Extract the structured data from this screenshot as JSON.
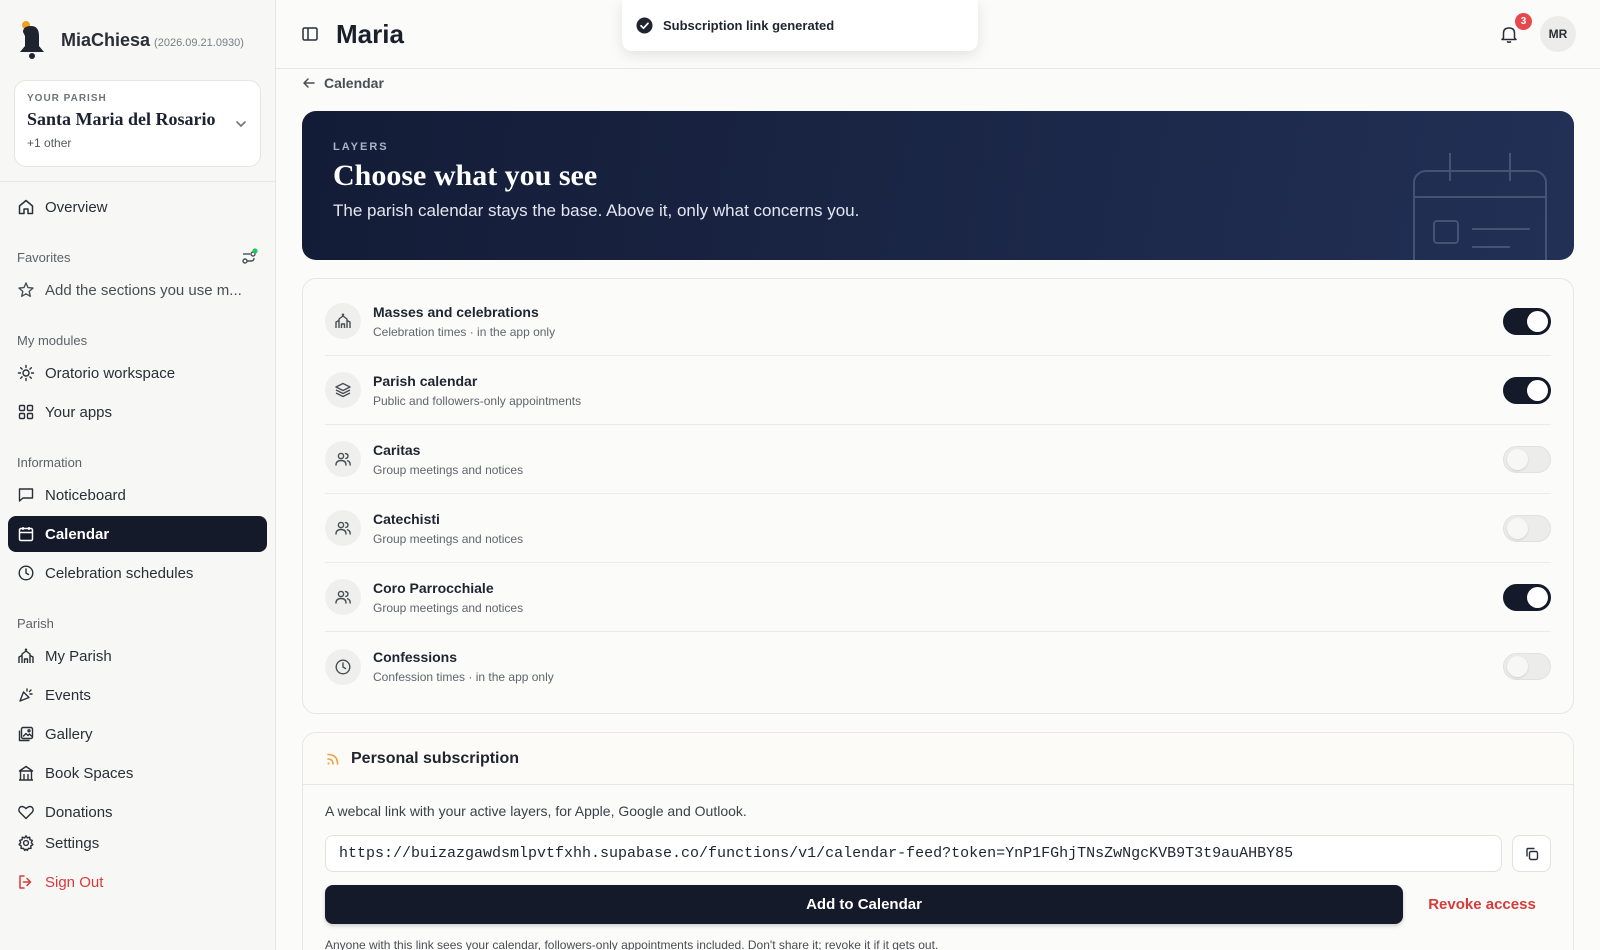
{
  "brand": {
    "name": "MiaChiesa",
    "version": "(2026.09.21.0930)"
  },
  "parish": {
    "kicker": "YOUR PARISH",
    "name": "Santa Maria del Rosario",
    "other": "+1 other"
  },
  "sidebar": {
    "overview": "Overview",
    "favorites_title": "Favorites",
    "favorites_hint": "Add the sections you use m...",
    "modules_title": "My modules",
    "modules": [
      "Oratorio workspace",
      "Your apps"
    ],
    "information_title": "Information",
    "information": [
      "Noticeboard",
      "Calendar",
      "Celebration schedules"
    ],
    "parish_title": "Parish",
    "parish": [
      "My Parish",
      "Events",
      "Gallery",
      "Book Spaces",
      "Donations"
    ],
    "settings": "Settings",
    "signout": "Sign Out"
  },
  "header": {
    "title": "Maria",
    "notifications_count": "3",
    "avatar_initials": "MR"
  },
  "toast": {
    "text": "Subscription link generated"
  },
  "breadcrumb": {
    "back_label": "Calendar"
  },
  "hero": {
    "kicker": "LAYERS",
    "title": "Choose what you see",
    "subtitle": "The parish calendar stays the base. Above it, only what concerns you."
  },
  "layers": [
    {
      "title": "Masses and celebrations",
      "subtitle": "Celebration times · in the app only",
      "icon": "church-icon",
      "enabled": true
    },
    {
      "title": "Parish calendar",
      "subtitle": "Public and followers-only appointments",
      "icon": "layers-icon",
      "enabled": true
    },
    {
      "title": "Caritas",
      "subtitle": "Group meetings and notices",
      "icon": "users-icon",
      "enabled": false
    },
    {
      "title": "Catechisti",
      "subtitle": "Group meetings and notices",
      "icon": "users-icon",
      "enabled": false
    },
    {
      "title": "Coro Parrocchiale",
      "subtitle": "Group meetings and notices",
      "icon": "users-icon",
      "enabled": true
    },
    {
      "title": "Confessions",
      "subtitle": "Confession times · in the app only",
      "icon": "clock-icon",
      "enabled": false
    }
  ],
  "subscription": {
    "title": "Personal subscription",
    "description": "A webcal link with your active layers, for Apple, Google and Outlook.",
    "url": "https://buizazgawdsmlpvtfxhh.supabase.co/functions/v1/calendar-feed?token=YnP1FGhjTNsZwNgcKVB9T3t9auAHBY85",
    "add_label": "Add to Calendar",
    "revoke_label": "Revoke access",
    "note": "Anyone with this link sees your calendar, followers-only appointments included. Don't share it; revoke it if it gets out."
  },
  "colors": {
    "primary": "#141a2a",
    "hero_bg": "#1a2545",
    "danger": "#d63b3b",
    "badge": "#e5484d",
    "online_dot": "#22c55e",
    "rss_accent": "#f0a040"
  }
}
